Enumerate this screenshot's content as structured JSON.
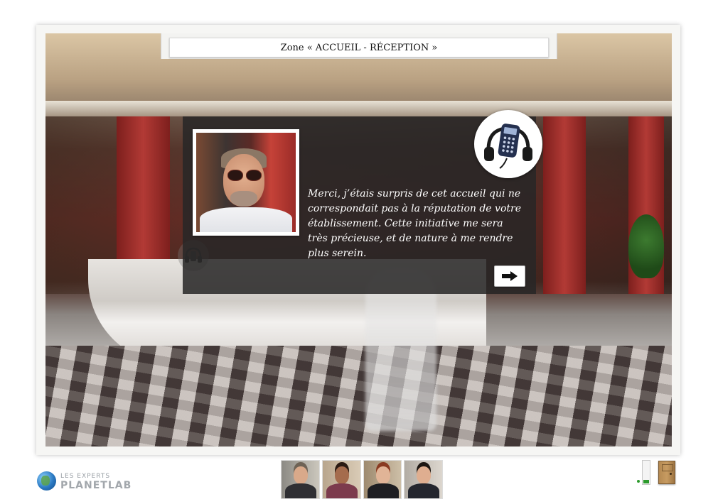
{
  "zone": {
    "title": "Zone « ACCUEIL - RÉCEPTION »"
  },
  "dialog": {
    "text": "Merci, j’étais surpris de cet accueil qui ne correspondait pas à la réputation de votre établissement. Cette initiative me sera très précieuse, et de nature à me rendre plus serein.",
    "speaker_icon": "portrait",
    "audio_icon": "headphones-audio-guide-icon",
    "next_icon": "right-arrow-icon"
  },
  "logo": {
    "line1": "LES EXPERTS",
    "line2": "PLANETLAB"
  },
  "characters": [
    {
      "icon": "character-1"
    },
    {
      "icon": "character-2"
    },
    {
      "icon": "character-3"
    },
    {
      "icon": "character-4"
    }
  ],
  "controls": {
    "level_fraction": 0.15,
    "level_color": "#2c9a2c",
    "exit_icon": "door-icon"
  }
}
